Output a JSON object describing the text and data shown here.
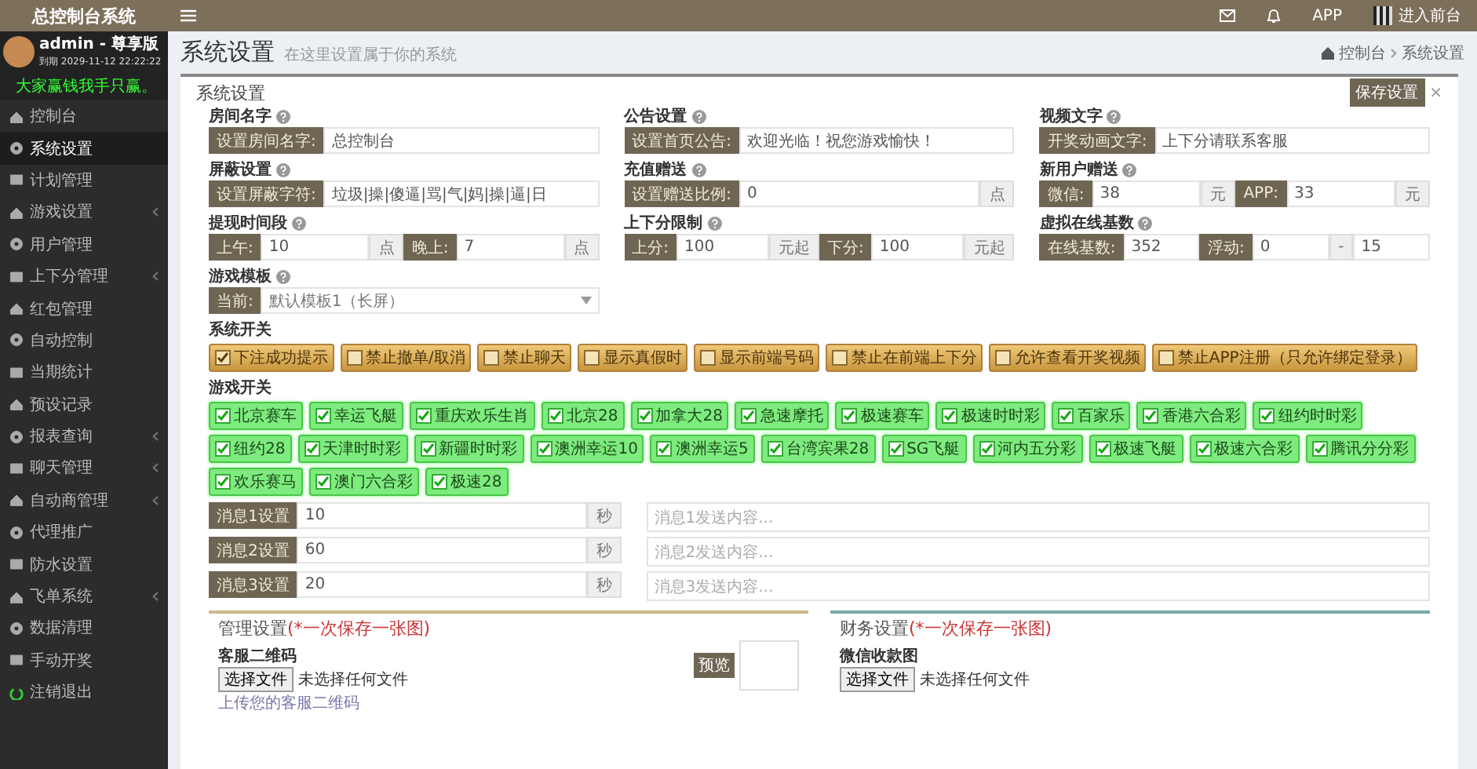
{
  "header": {
    "title": "总控制台系统",
    "app_label": "APP",
    "enter_label": "进入前台"
  },
  "user": {
    "name": "admin - 尊享版",
    "expiry_label": "到期",
    "expiry": "2029-11-12 22:22:22",
    "motto": "大家赢钱我手只赢。"
  },
  "sidebar": {
    "items": [
      {
        "label": "控制台",
        "selected": false,
        "submenu": false
      },
      {
        "label": "系统设置",
        "selected": true,
        "submenu": false
      },
      {
        "label": "计划管理",
        "selected": false,
        "submenu": false
      },
      {
        "label": "游戏设置",
        "selected": false,
        "submenu": true
      },
      {
        "label": "用户管理",
        "selected": false,
        "submenu": false
      },
      {
        "label": "上下分管理",
        "selected": false,
        "submenu": true
      },
      {
        "label": "红包管理",
        "selected": false,
        "submenu": false
      },
      {
        "label": "自动控制",
        "selected": false,
        "submenu": false
      },
      {
        "label": "当期统计",
        "selected": false,
        "submenu": false
      },
      {
        "label": "预设记录",
        "selected": false,
        "submenu": false
      },
      {
        "label": "报表查询",
        "selected": false,
        "submenu": true
      },
      {
        "label": "聊天管理",
        "selected": false,
        "submenu": true
      },
      {
        "label": "自动商管理",
        "selected": false,
        "submenu": true
      },
      {
        "label": "代理推广",
        "selected": false,
        "submenu": false
      },
      {
        "label": "防水设置",
        "selected": false,
        "submenu": false
      },
      {
        "label": "飞单系统",
        "selected": false,
        "submenu": true
      },
      {
        "label": "数据清理",
        "selected": false,
        "submenu": false
      },
      {
        "label": "手动开奖",
        "selected": false,
        "submenu": false
      },
      {
        "label": "注销退出",
        "selected": false,
        "submenu": false,
        "kind": "logout"
      }
    ]
  },
  "page": {
    "title": "系统设置",
    "subtitle": "在这里设置属于你的系统",
    "breadcrumb": [
      "控制台",
      "系统设置"
    ]
  },
  "panel": {
    "title": "系统设置",
    "save_button": "保存设置",
    "close_glyph": "×"
  },
  "field_groups": [
    {
      "label": "房间名字",
      "segments": [
        {
          "kind": "label",
          "text": "设置房间名字:"
        },
        {
          "kind": "input",
          "text": "总控制台"
        }
      ]
    },
    {
      "label": "公告设置",
      "segments": [
        {
          "kind": "label",
          "text": "设置首页公告:"
        },
        {
          "kind": "input",
          "text": "欢迎光临！祝您游戏愉快！"
        }
      ]
    },
    {
      "label": "视频文字",
      "segments": [
        {
          "kind": "label",
          "text": "开奖动画文字:"
        },
        {
          "kind": "input",
          "text": "上下分请联系客服"
        }
      ]
    },
    {
      "label": "屏蔽设置",
      "segments": [
        {
          "kind": "label",
          "text": "设置屏蔽字符:"
        },
        {
          "kind": "input",
          "text": "垃圾|操|傻逼|骂|气|妈|操|逼|日"
        }
      ]
    },
    {
      "label": "充值赠送",
      "segments": [
        {
          "kind": "label",
          "text": "设置赠送比例:"
        },
        {
          "kind": "input",
          "text": "0"
        },
        {
          "kind": "addon",
          "text": "点"
        }
      ]
    },
    {
      "label": "新用户赠送",
      "segments": [
        {
          "kind": "label",
          "text": "微信:"
        },
        {
          "kind": "input",
          "text": "38"
        },
        {
          "kind": "addon",
          "text": "元"
        },
        {
          "kind": "label",
          "text": "APP:"
        },
        {
          "kind": "input",
          "text": "33"
        },
        {
          "kind": "addon",
          "text": "元"
        }
      ]
    },
    {
      "label": "提现时间段",
      "segments": [
        {
          "kind": "label",
          "text": "上午:"
        },
        {
          "kind": "input",
          "text": "10"
        },
        {
          "kind": "addon",
          "text": "点"
        },
        {
          "kind": "label",
          "text": "晚上:"
        },
        {
          "kind": "input",
          "text": "7"
        },
        {
          "kind": "addon",
          "text": "点"
        }
      ]
    },
    {
      "label": "上下分限制",
      "segments": [
        {
          "kind": "label",
          "text": "上分:"
        },
        {
          "kind": "input",
          "text": "100"
        },
        {
          "kind": "addon",
          "text": "元起"
        },
        {
          "kind": "label",
          "text": "下分:"
        },
        {
          "kind": "input",
          "text": "100"
        },
        {
          "kind": "addon",
          "text": "元起"
        }
      ]
    },
    {
      "label": "虚拟在线基数",
      "segments": [
        {
          "kind": "label",
          "text": "在线基数:"
        },
        {
          "kind": "input",
          "text": "352"
        },
        {
          "kind": "label",
          "text": "浮动:"
        },
        {
          "kind": "input",
          "text": "0"
        },
        {
          "kind": "addon",
          "text": "-"
        },
        {
          "kind": "input",
          "text": "15"
        }
      ]
    },
    {
      "label": "游戏模板",
      "segments": [
        {
          "kind": "label",
          "text": "当前:"
        },
        {
          "kind": "select",
          "text": "默认模板1（长屏）"
        }
      ]
    }
  ],
  "system_switches": {
    "label": "系统开关",
    "items": [
      {
        "label": "下注成功提示",
        "checked": true
      },
      {
        "label": "禁止撤单/取消",
        "checked": false
      },
      {
        "label": "禁止聊天",
        "checked": false
      },
      {
        "label": "显示真假时",
        "checked": false
      },
      {
        "label": "显示前端号码",
        "checked": false
      },
      {
        "label": "禁止在前端上下分",
        "checked": false
      },
      {
        "label": "允许查看开奖视频",
        "checked": false
      },
      {
        "label": "禁止APP注册（只允许绑定登录）",
        "checked": false
      }
    ]
  },
  "game_switches": {
    "label": "游戏开关",
    "items": [
      {
        "label": "北京赛车",
        "checked": true
      },
      {
        "label": "幸运飞艇",
        "checked": true
      },
      {
        "label": "重庆欢乐生肖",
        "checked": true
      },
      {
        "label": "北京28",
        "checked": true
      },
      {
        "label": "加拿大28",
        "checked": true
      },
      {
        "label": "急速摩托",
        "checked": true
      },
      {
        "label": "极速赛车",
        "checked": true
      },
      {
        "label": "极速时时彩",
        "checked": true
      },
      {
        "label": "百家乐",
        "checked": true
      },
      {
        "label": "香港六合彩",
        "checked": true
      },
      {
        "label": "纽约时时彩",
        "checked": true
      },
      {
        "label": "纽约28",
        "checked": true
      },
      {
        "label": "天津时时彩",
        "checked": true
      },
      {
        "label": "新疆时时彩",
        "checked": true
      },
      {
        "label": "澳洲幸运10",
        "checked": true
      },
      {
        "label": "澳洲幸运5",
        "checked": true
      },
      {
        "label": "台湾宾果28",
        "checked": true
      },
      {
        "label": "SG飞艇",
        "checked": true
      },
      {
        "label": "河内五分彩",
        "checked": true
      },
      {
        "label": "极速飞艇",
        "checked": true
      },
      {
        "label": "极速六合彩",
        "checked": true
      },
      {
        "label": "腾讯分分彩",
        "checked": true
      },
      {
        "label": "欢乐赛马",
        "checked": true
      },
      {
        "label": "澳门六合彩",
        "checked": true
      },
      {
        "label": "极速28",
        "checked": true
      }
    ]
  },
  "messages": [
    {
      "label": "消息1设置",
      "value": "10",
      "unit": "秒",
      "placeholder": "消息1发送内容..."
    },
    {
      "label": "消息2设置",
      "value": "60",
      "unit": "秒",
      "placeholder": "消息2发送内容..."
    },
    {
      "label": "消息3设置",
      "value": "20",
      "unit": "秒",
      "placeholder": "消息3发送内容..."
    }
  ],
  "management": {
    "title": "管理设置",
    "note": "(*一次保存一张图)",
    "field_label": "客服二维码",
    "file_button": "选择文件",
    "file_status": "未选择任何文件",
    "hint": "上传您的客服二维码",
    "preview_button": "预览"
  },
  "finance": {
    "title": "财务设置",
    "note": "(*一次保存一张图)",
    "field_label": "微信收款图",
    "file_button": "选择文件",
    "file_status": "未选择任何文件"
  }
}
